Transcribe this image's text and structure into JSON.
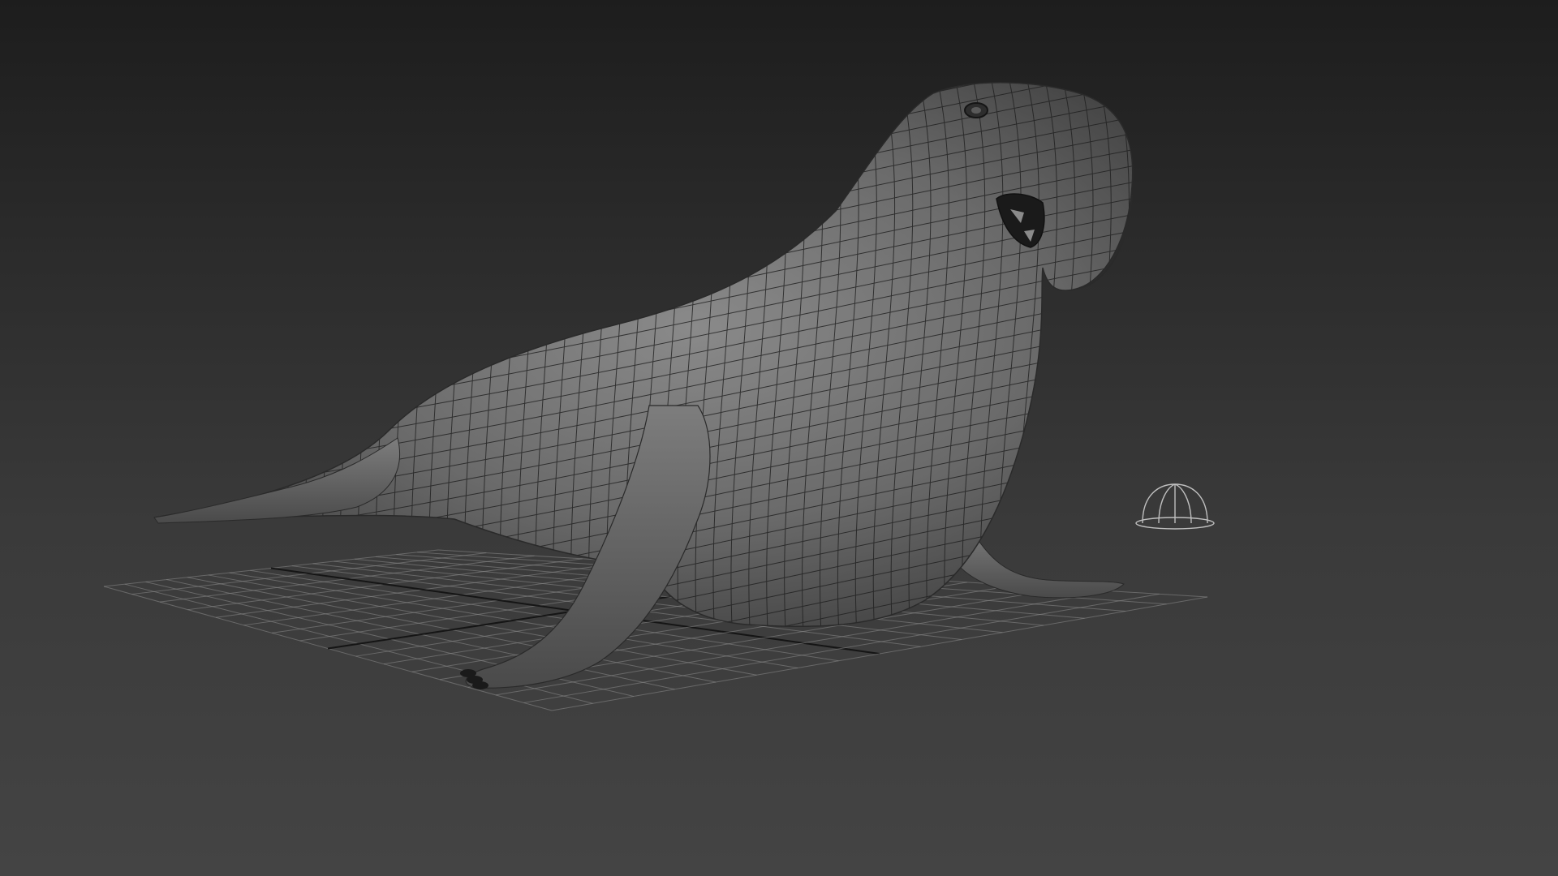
{
  "viewport": {
    "background_top": "#1d1d1d",
    "background_bottom": "#444444"
  },
  "scene": {
    "subject": "elephant-seal-wireframe-model",
    "shading": "gray-clay",
    "wireframe_color": "#1a1a1a",
    "mesh_color": "#6e6e6e",
    "grid_color": "#8c8c8c",
    "grid_axis_color": "#111111",
    "light_helper_icon": "dome-light-icon"
  }
}
